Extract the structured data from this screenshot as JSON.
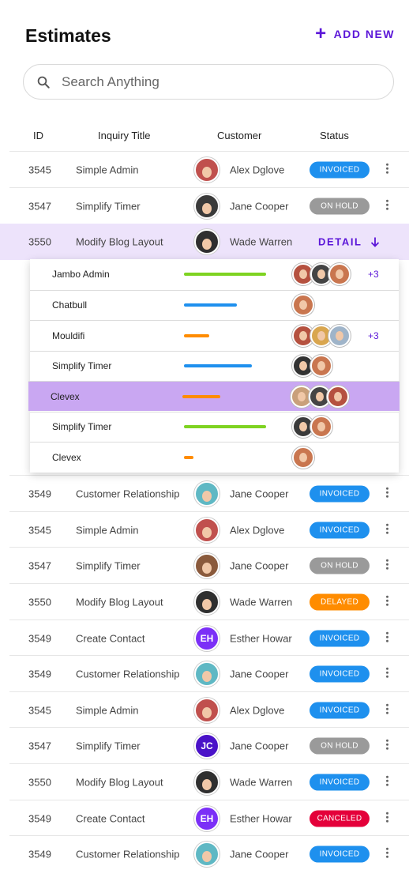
{
  "header": {
    "title": "Estimates",
    "add_new_label": "ADD NEW"
  },
  "search": {
    "placeholder": "Search Anything"
  },
  "columns": {
    "id": "ID",
    "title": "Inquiry Title",
    "customer": "Customer",
    "status": "Status"
  },
  "status_colors": {
    "INVOICED": "#1e90ee",
    "ON HOLD": "#9a9a9a",
    "DELAYED": "#ff8c00",
    "CANCELED": "#e4003a"
  },
  "rows_top": [
    {
      "id": "3545",
      "title": "Simple Admin",
      "customer": "Alex Dglove",
      "avatar_color": "#c0504d",
      "status": "INVOICED"
    },
    {
      "id": "3547",
      "title": "Simplify Timer",
      "customer": "Jane Cooper",
      "avatar_color": "#3a3a3a",
      "status": "ON HOLD"
    }
  ],
  "selected_row": {
    "id": "3550",
    "title": "Modify Blog Layout",
    "customer": "Wade Warren",
    "avatar_color": "#2f2f2f",
    "detail_label": "DETAIL"
  },
  "panel": [
    {
      "name": "Jambo Admin",
      "bar_color": "#7ed321",
      "progress": 0.72,
      "avatars": [
        "#b5513f",
        "#444444",
        "#c9764f"
      ],
      "more": "+3"
    },
    {
      "name": "Chatbull",
      "bar_color": "#1e90ee",
      "progress": 0.46,
      "avatars": [
        "#c9764f"
      ],
      "more": ""
    },
    {
      "name": "Mouldifi",
      "bar_color": "#ff8c00",
      "progress": 0.22,
      "avatars": [
        "#b5513f",
        "#d9a64f",
        "#9fb4c9"
      ],
      "more": "+3"
    },
    {
      "name": "Simplify Timer",
      "bar_color": "#1e90ee",
      "progress": 0.59,
      "avatars": [
        "#333333",
        "#c9764f"
      ],
      "more": ""
    },
    {
      "name": "Clevex",
      "bar_color": "#ff8c00",
      "progress": 0.33,
      "avatars": [
        "#c9a07a",
        "#444444",
        "#b5513f"
      ],
      "more": ""
    },
    {
      "name": "Simplify Timer",
      "bar_color": "#7ed321",
      "progress": 0.72,
      "avatars": [
        "#3a3a3a",
        "#c9764f"
      ],
      "more": ""
    },
    {
      "name": "Clevex",
      "bar_color": "#ff8c00",
      "progress": 0.08,
      "avatars": [
        "#c9764f"
      ],
      "more": ""
    }
  ],
  "rows_bottom": [
    {
      "id": "3549",
      "title": "Customer Relationship",
      "customer": "Jane Cooper",
      "avatar_color": "#5fb8c4",
      "initials": "",
      "status": "INVOICED"
    },
    {
      "id": "3545",
      "title": "Simple Admin",
      "customer": "Alex Dglove",
      "avatar_color": "#c0504d",
      "initials": "",
      "status": "INVOICED"
    },
    {
      "id": "3547",
      "title": "Simplify Timer",
      "customer": "Jane Cooper",
      "avatar_color": "#8a5a3c",
      "initials": "",
      "status": "ON HOLD"
    },
    {
      "id": "3550",
      "title": "Modify Blog Layout",
      "customer": "Wade Warren",
      "avatar_color": "#2f2f2f",
      "initials": "",
      "status": "DELAYED"
    },
    {
      "id": "3549",
      "title": "Create Contact",
      "customer": "Esther Howar",
      "avatar_color": "#7b2ff7",
      "initials": "EH",
      "status": "INVOICED"
    },
    {
      "id": "3549",
      "title": "Customer Relationship",
      "customer": "Jane Cooper",
      "avatar_color": "#5fb8c4",
      "initials": "",
      "status": "INVOICED"
    },
    {
      "id": "3545",
      "title": "Simple Admin",
      "customer": "Alex Dglove",
      "avatar_color": "#c0504d",
      "initials": "",
      "status": "INVOICED"
    },
    {
      "id": "3547",
      "title": "Simplify Timer",
      "customer": "Jane Cooper",
      "avatar_color": "#4a12c8",
      "initials": "JC",
      "status": "ON HOLD"
    },
    {
      "id": "3550",
      "title": "Modify Blog Layout",
      "customer": "Wade Warren",
      "avatar_color": "#2f2f2f",
      "initials": "",
      "status": "INVOICED"
    },
    {
      "id": "3549",
      "title": "Create Contact",
      "customer": "Esther Howar",
      "avatar_color": "#7b2ff7",
      "initials": "EH",
      "status": "CANCELED"
    },
    {
      "id": "3549",
      "title": "Customer Relationship",
      "customer": "Jane Cooper",
      "avatar_color": "#5fb8c4",
      "initials": "",
      "status": "INVOICED"
    }
  ]
}
